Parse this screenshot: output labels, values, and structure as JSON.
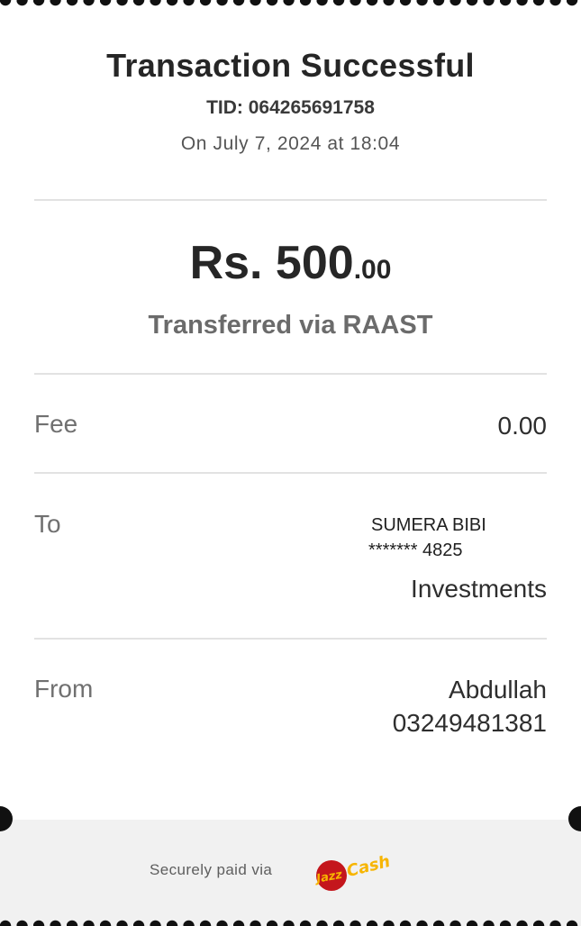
{
  "receipt": {
    "title": "Transaction Successful",
    "tid": "TID: 064265691758",
    "date": "On July 7, 2024 at 18:04",
    "amount_main": "Rs. 500",
    "amount_decimals": ".00",
    "transfer_method": "Transferred via RAAST"
  },
  "fee": {
    "label": "Fee",
    "value": "0.00"
  },
  "to": {
    "label": "To",
    "name": "SUMERA BIBI",
    "account": "******* 4825",
    "bank": "Investments"
  },
  "from": {
    "label": "From",
    "name": "Abdullah",
    "number": "03249481381"
  },
  "footer": {
    "secure_text": "Securely paid via",
    "logo_text": "JazzCash"
  },
  "colors": {
    "logo_red": "#c4161c",
    "logo_yellow": "#f7b500",
    "footer_bg": "#f1f1f1",
    "divider": "#e2e2e2"
  },
  "icons": {
    "brand_logo": "jazzcash-logo"
  }
}
